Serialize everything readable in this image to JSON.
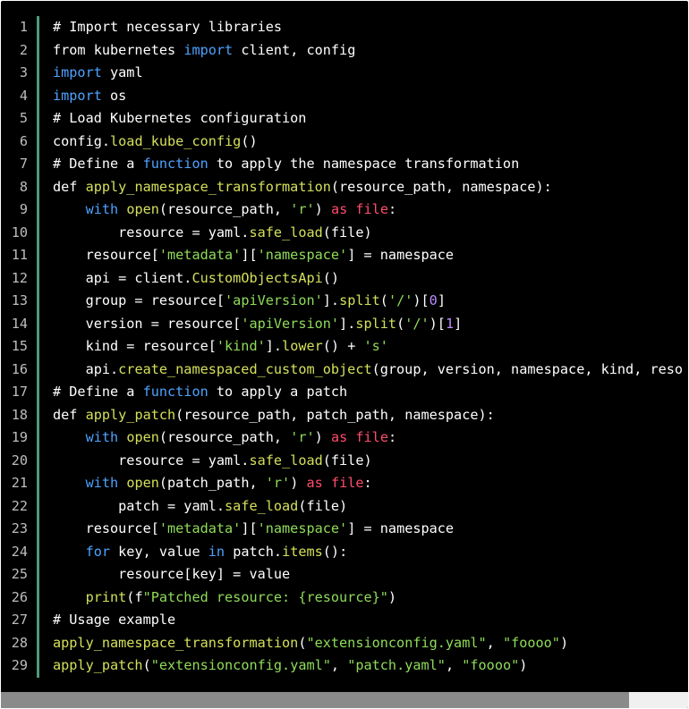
{
  "lines": [
    {
      "n": "1",
      "tokens": [
        {
          "t": "# Import necessary libraries",
          "c": "cm"
        }
      ]
    },
    {
      "n": "2",
      "tokens": [
        {
          "t": "from kubernetes ",
          "c": "pl"
        },
        {
          "t": "import",
          "c": "kw"
        },
        {
          "t": " client, config",
          "c": "pl"
        }
      ]
    },
    {
      "n": "3",
      "tokens": [
        {
          "t": "import",
          "c": "kw"
        },
        {
          "t": " yaml",
          "c": "pl"
        }
      ]
    },
    {
      "n": "4",
      "tokens": [
        {
          "t": "import",
          "c": "kw"
        },
        {
          "t": " os",
          "c": "pl"
        }
      ]
    },
    {
      "n": "5",
      "tokens": [
        {
          "t": "# Load Kubernetes configuration",
          "c": "cm"
        }
      ]
    },
    {
      "n": "6",
      "tokens": [
        {
          "t": "config.",
          "c": "pl"
        },
        {
          "t": "load_kube_config",
          "c": "fn"
        },
        {
          "t": "()",
          "c": "pl"
        }
      ]
    },
    {
      "n": "7",
      "tokens": [
        {
          "t": "# Define a ",
          "c": "cm"
        },
        {
          "t": "function",
          "c": "kw"
        },
        {
          "t": " to apply the namespace transformation",
          "c": "cm"
        }
      ]
    },
    {
      "n": "8",
      "tokens": [
        {
          "t": "def ",
          "c": "pl"
        },
        {
          "t": "apply_namespace_transformation",
          "c": "fn"
        },
        {
          "t": "(resource_path, namespace):",
          "c": "pl"
        }
      ]
    },
    {
      "n": "9",
      "tokens": [
        {
          "t": "    ",
          "c": "pl"
        },
        {
          "t": "with",
          "c": "kw"
        },
        {
          "t": " ",
          "c": "pl"
        },
        {
          "t": "open",
          "c": "fn"
        },
        {
          "t": "(resource_path, ",
          "c": "pl"
        },
        {
          "t": "'r'",
          "c": "st"
        },
        {
          "t": ") ",
          "c": "pl"
        },
        {
          "t": "as",
          "c": "bi"
        },
        {
          "t": " ",
          "c": "pl"
        },
        {
          "t": "file",
          "c": "bi"
        },
        {
          "t": ":",
          "c": "pl"
        }
      ]
    },
    {
      "n": "10",
      "tokens": [
        {
          "t": "        resource = yaml.",
          "c": "pl"
        },
        {
          "t": "safe_load",
          "c": "fn"
        },
        {
          "t": "(file)",
          "c": "pl"
        }
      ]
    },
    {
      "n": "11",
      "tokens": [
        {
          "t": "    resource[",
          "c": "pl"
        },
        {
          "t": "'metadata'",
          "c": "st"
        },
        {
          "t": "][",
          "c": "pl"
        },
        {
          "t": "'namespace'",
          "c": "st"
        },
        {
          "t": "] = namespace",
          "c": "pl"
        }
      ]
    },
    {
      "n": "12",
      "tokens": [
        {
          "t": "    api = client.",
          "c": "pl"
        },
        {
          "t": "CustomObjectsApi",
          "c": "fn"
        },
        {
          "t": "()",
          "c": "pl"
        }
      ]
    },
    {
      "n": "13",
      "tokens": [
        {
          "t": "    group = resource[",
          "c": "pl"
        },
        {
          "t": "'apiVersion'",
          "c": "st"
        },
        {
          "t": "].",
          "c": "pl"
        },
        {
          "t": "split",
          "c": "fn"
        },
        {
          "t": "(",
          "c": "pl"
        },
        {
          "t": "'/'",
          "c": "st"
        },
        {
          "t": ")[",
          "c": "pl"
        },
        {
          "t": "0",
          "c": "nm"
        },
        {
          "t": "]",
          "c": "pl"
        }
      ]
    },
    {
      "n": "14",
      "tokens": [
        {
          "t": "    version = resource[",
          "c": "pl"
        },
        {
          "t": "'apiVersion'",
          "c": "st"
        },
        {
          "t": "].",
          "c": "pl"
        },
        {
          "t": "split",
          "c": "fn"
        },
        {
          "t": "(",
          "c": "pl"
        },
        {
          "t": "'/'",
          "c": "st"
        },
        {
          "t": ")[",
          "c": "pl"
        },
        {
          "t": "1",
          "c": "nm"
        },
        {
          "t": "]",
          "c": "pl"
        }
      ]
    },
    {
      "n": "15",
      "tokens": [
        {
          "t": "    kind = resource[",
          "c": "pl"
        },
        {
          "t": "'kind'",
          "c": "st"
        },
        {
          "t": "].",
          "c": "pl"
        },
        {
          "t": "lower",
          "c": "fn"
        },
        {
          "t": "() + ",
          "c": "pl"
        },
        {
          "t": "'s'",
          "c": "st"
        }
      ]
    },
    {
      "n": "16",
      "tokens": [
        {
          "t": "    api.",
          "c": "pl"
        },
        {
          "t": "create_namespaced_custom_object",
          "c": "fn"
        },
        {
          "t": "(group, version, namespace, kind, reso",
          "c": "pl"
        }
      ]
    },
    {
      "n": "17",
      "tokens": [
        {
          "t": "# Define a ",
          "c": "cm"
        },
        {
          "t": "function",
          "c": "kw"
        },
        {
          "t": " to apply a patch",
          "c": "cm"
        }
      ]
    },
    {
      "n": "18",
      "tokens": [
        {
          "t": "def ",
          "c": "pl"
        },
        {
          "t": "apply_patch",
          "c": "fn"
        },
        {
          "t": "(resource_path, patch_path, namespace):",
          "c": "pl"
        }
      ]
    },
    {
      "n": "19",
      "tokens": [
        {
          "t": "    ",
          "c": "pl"
        },
        {
          "t": "with",
          "c": "kw"
        },
        {
          "t": " ",
          "c": "pl"
        },
        {
          "t": "open",
          "c": "fn"
        },
        {
          "t": "(resource_path, ",
          "c": "pl"
        },
        {
          "t": "'r'",
          "c": "st"
        },
        {
          "t": ") ",
          "c": "pl"
        },
        {
          "t": "as",
          "c": "bi"
        },
        {
          "t": " ",
          "c": "pl"
        },
        {
          "t": "file",
          "c": "bi"
        },
        {
          "t": ":",
          "c": "pl"
        }
      ]
    },
    {
      "n": "20",
      "tokens": [
        {
          "t": "        resource = yaml.",
          "c": "pl"
        },
        {
          "t": "safe_load",
          "c": "fn"
        },
        {
          "t": "(file)",
          "c": "pl"
        }
      ]
    },
    {
      "n": "21",
      "tokens": [
        {
          "t": "    ",
          "c": "pl"
        },
        {
          "t": "with",
          "c": "kw"
        },
        {
          "t": " ",
          "c": "pl"
        },
        {
          "t": "open",
          "c": "fn"
        },
        {
          "t": "(patch_path, ",
          "c": "pl"
        },
        {
          "t": "'r'",
          "c": "st"
        },
        {
          "t": ") ",
          "c": "pl"
        },
        {
          "t": "as",
          "c": "bi"
        },
        {
          "t": " ",
          "c": "pl"
        },
        {
          "t": "file",
          "c": "bi"
        },
        {
          "t": ":",
          "c": "pl"
        }
      ]
    },
    {
      "n": "22",
      "tokens": [
        {
          "t": "        patch = yaml.",
          "c": "pl"
        },
        {
          "t": "safe_load",
          "c": "fn"
        },
        {
          "t": "(file)",
          "c": "pl"
        }
      ]
    },
    {
      "n": "23",
      "tokens": [
        {
          "t": "    resource[",
          "c": "pl"
        },
        {
          "t": "'metadata'",
          "c": "st"
        },
        {
          "t": "][",
          "c": "pl"
        },
        {
          "t": "'namespace'",
          "c": "st"
        },
        {
          "t": "] = namespace",
          "c": "pl"
        }
      ]
    },
    {
      "n": "24",
      "tokens": [
        {
          "t": "    ",
          "c": "pl"
        },
        {
          "t": "for",
          "c": "kw"
        },
        {
          "t": " key, value ",
          "c": "pl"
        },
        {
          "t": "in",
          "c": "kw"
        },
        {
          "t": " patch.",
          "c": "pl"
        },
        {
          "t": "items",
          "c": "fn"
        },
        {
          "t": "():",
          "c": "pl"
        }
      ]
    },
    {
      "n": "25",
      "tokens": [
        {
          "t": "        resource[key] = value",
          "c": "pl"
        }
      ]
    },
    {
      "n": "26",
      "tokens": [
        {
          "t": "    ",
          "c": "pl"
        },
        {
          "t": "print",
          "c": "fn"
        },
        {
          "t": "(f",
          "c": "pl"
        },
        {
          "t": "\"Patched resource: {resource}\"",
          "c": "st"
        },
        {
          "t": ")",
          "c": "pl"
        }
      ]
    },
    {
      "n": "27",
      "tokens": [
        {
          "t": "# Usage example",
          "c": "cm"
        }
      ]
    },
    {
      "n": "28",
      "tokens": [
        {
          "t": "apply_namespace_transformation",
          "c": "fn"
        },
        {
          "t": "(",
          "c": "pl"
        },
        {
          "t": "\"extensionconfig.yaml\"",
          "c": "st"
        },
        {
          "t": ", ",
          "c": "pl"
        },
        {
          "t": "\"foooo\"",
          "c": "st"
        },
        {
          "t": ")",
          "c": "pl"
        }
      ]
    },
    {
      "n": "29",
      "tokens": [
        {
          "t": "apply_patch",
          "c": "fn"
        },
        {
          "t": "(",
          "c": "pl"
        },
        {
          "t": "\"extensionconfig.yaml\"",
          "c": "st"
        },
        {
          "t": ", ",
          "c": "pl"
        },
        {
          "t": "\"patch.yaml\"",
          "c": "st"
        },
        {
          "t": ", ",
          "c": "pl"
        },
        {
          "t": "\"foooo\"",
          "c": "st"
        },
        {
          "t": ")",
          "c": "pl"
        }
      ]
    }
  ],
  "colors": {
    "background": "#000000",
    "gutter_bar": "#4f9a7a",
    "keyword": "#4ea2ff",
    "function": "#d4e05a",
    "string": "#8fdc5a",
    "builtin": "#ff4d6b",
    "number": "#b98cff"
  },
  "scroll": {
    "horizontal_position": 0
  }
}
